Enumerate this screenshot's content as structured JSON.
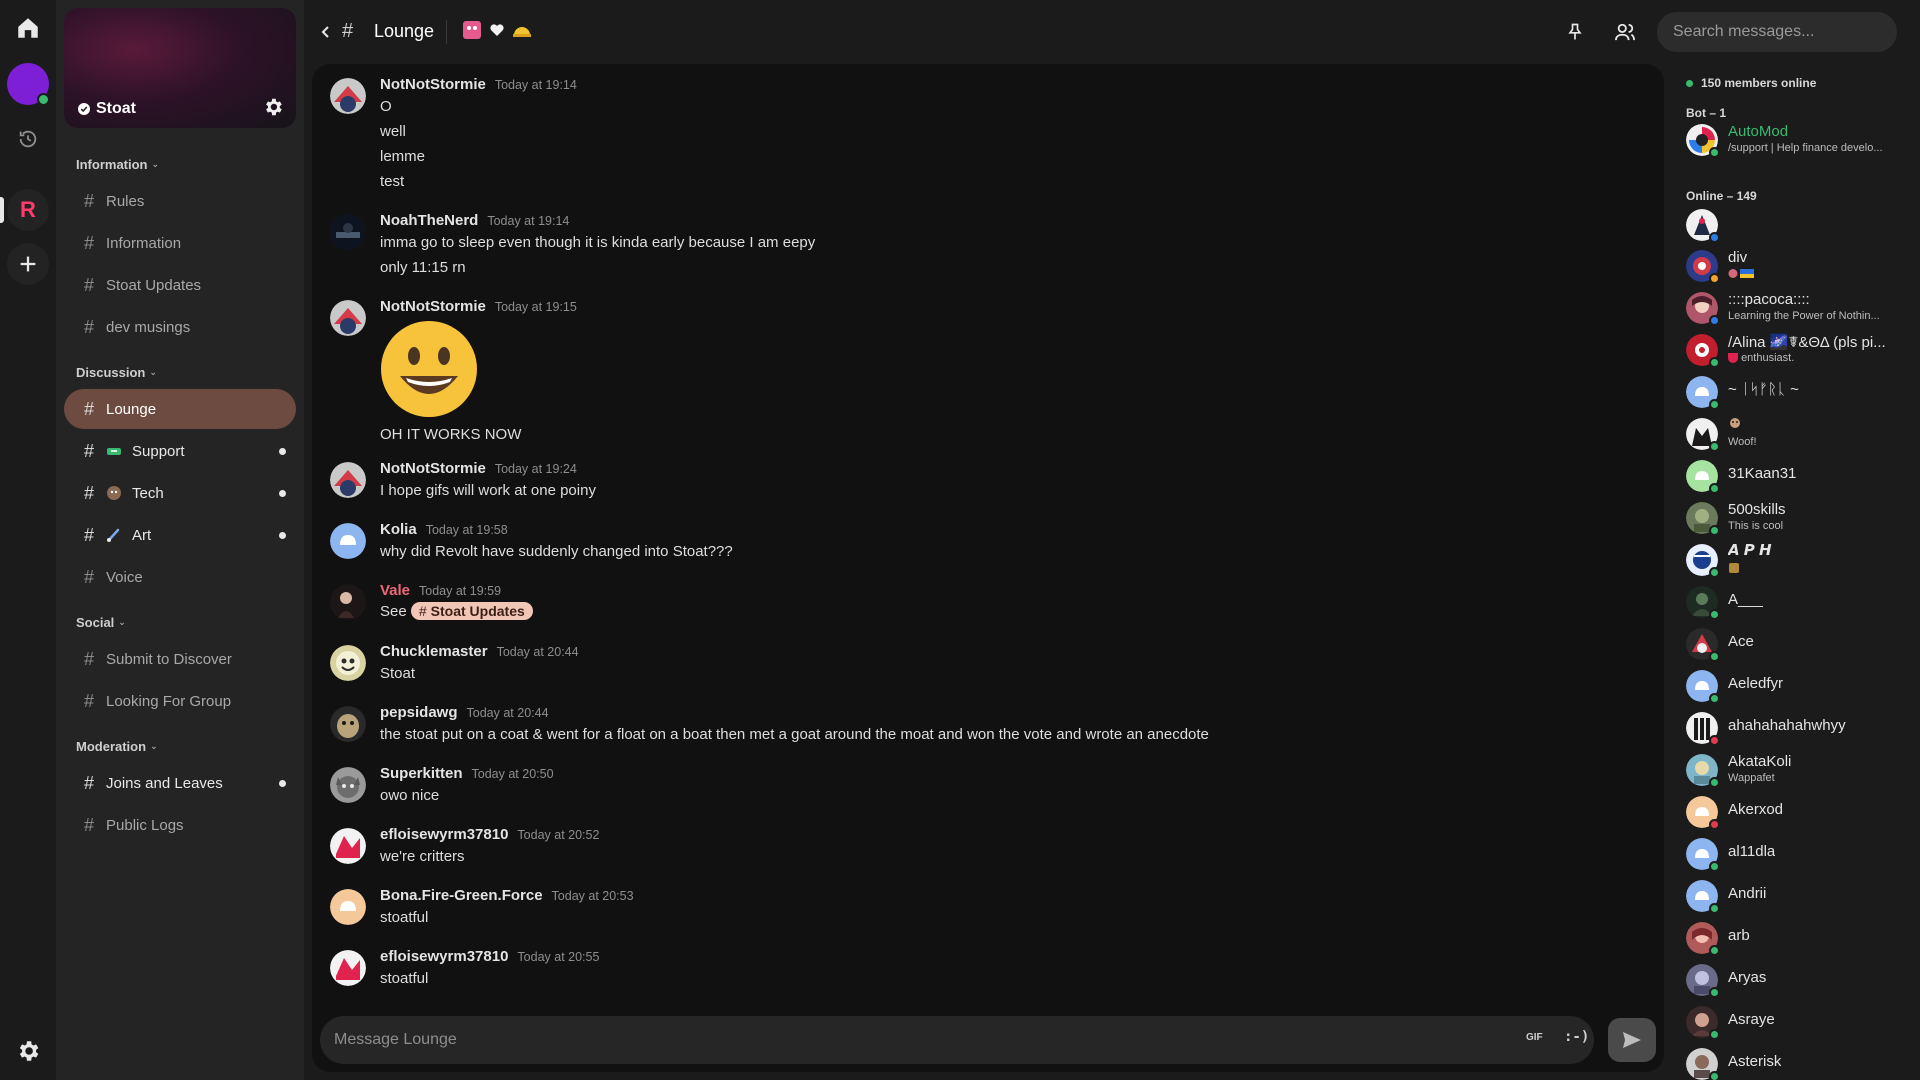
{
  "colors": {
    "accent_active_channel": "#6e4b41",
    "online": "#3aba6e",
    "busy": "#e23b4e",
    "idle": "#f0a32f",
    "bot_name": "#3aba6e",
    "mention_bg": "#f2c6b7",
    "server_letter": "#ff3b6b"
  },
  "rail": {
    "server_letter": "R"
  },
  "server": {
    "name": "Stoat"
  },
  "categories": {
    "information": "Information",
    "discussion": "Discussion",
    "social": "Social",
    "moderation": "Moderation"
  },
  "channels": {
    "rules": "Rules",
    "information": "Information",
    "stoat_updates": "Stoat Updates",
    "dev_musings": "dev musings",
    "lounge": "Lounge",
    "support": "Support",
    "tech": "Tech",
    "art": "Art",
    "voice": "Voice",
    "submit": "Submit to Discover",
    "lfg": "Looking For Group",
    "joins": "Joins and Leaves",
    "public_logs": "Public Logs"
  },
  "header": {
    "channel": "Lounge",
    "search_placeholder": "Search messages..."
  },
  "messages": [
    {
      "author": "NotNotStormie",
      "time": "Today at 19:14",
      "lines": [
        "O",
        "well",
        "lemme",
        "test"
      ]
    },
    {
      "author": "NoahTheNerd",
      "time": "Today at 19:14",
      "lines": [
        "imma go to sleep even though it is kinda early because I am eepy",
        "only 11:15 rn"
      ]
    },
    {
      "author": "NotNotStormie",
      "time": "Today at 19:15",
      "lines": [
        "OH IT WORKS NOW"
      ]
    },
    {
      "author": "NotNotStormie",
      "time": "Today at 19:24",
      "lines": [
        "I hope gifs will work at one poiny"
      ]
    },
    {
      "author": "Kolia",
      "time": "Today at 19:58",
      "lines": [
        "why did Revolt have suddenly changed into Stoat???"
      ]
    },
    {
      "author": "Vale",
      "time": "Today at 19:59",
      "lines": [
        "See"
      ],
      "mention": "Stoat Updates"
    },
    {
      "author": "Chucklemaster",
      "time": "Today at 20:44",
      "lines": [
        "Stoat"
      ]
    },
    {
      "author": "pepsidawg",
      "time": "Today at 20:44",
      "lines": [
        "the stoat put on a coat & went for a float on a boat then met a goat around the moat and won the vote and wrote an anecdote"
      ]
    },
    {
      "author": "Superkitten",
      "time": "Today at 20:50",
      "lines": [
        "owo nice"
      ]
    },
    {
      "author": "efloisewyrm37810",
      "time": "Today at 20:52",
      "lines": [
        "we're critters"
      ]
    },
    {
      "author": "Bona.Fire-Green.Force",
      "time": "Today at 20:53",
      "lines": [
        "stoatful"
      ]
    },
    {
      "author": "efloisewyrm37810",
      "time": "Today at 20:55",
      "lines": [
        "stoatful"
      ]
    }
  ],
  "composer": {
    "placeholder": "Message Lounge",
    "gif_label": "GIF",
    "emoji_label": ":-)"
  },
  "members_panel": {
    "online_count": "150 members online",
    "bot_header": "Bot – 1",
    "online_header": "Online – 149",
    "bot": {
      "name": "AutoMod",
      "status": "/support | Help finance develo..."
    },
    "members": [
      {
        "name": "",
        "status": ""
      },
      {
        "name": "div",
        "status": ""
      },
      {
        "name": "::::pacoca::::",
        "status": "Learning the Power of Nothin..."
      },
      {
        "name": "/Alina 🌌☤&ΘΔ (pls pi...",
        "status": "enthusiast."
      },
      {
        "name": "~ ᛁᛋᚠᚱᚳ ~",
        "status": ""
      },
      {
        "name": "",
        "status": "Woof!"
      },
      {
        "name": "31Kaan31",
        "status": ""
      },
      {
        "name": "500skills",
        "status": "This is cool"
      },
      {
        "name": "𝘼 𝙋 𝙃",
        "status": ""
      },
      {
        "name": "A___",
        "status": ""
      },
      {
        "name": "Ace",
        "status": ""
      },
      {
        "name": "Aeledfyr",
        "status": ""
      },
      {
        "name": "ahahahahahwhyy",
        "status": ""
      },
      {
        "name": "AkataKoli",
        "status": "Wappafet"
      },
      {
        "name": "Akerxod",
        "status": ""
      },
      {
        "name": "al11dla",
        "status": ""
      },
      {
        "name": "Andrii",
        "status": ""
      },
      {
        "name": "arb",
        "status": ""
      },
      {
        "name": "Aryas",
        "status": ""
      },
      {
        "name": "Asraye",
        "status": ""
      },
      {
        "name": "Asterisk",
        "status": ""
      }
    ]
  }
}
